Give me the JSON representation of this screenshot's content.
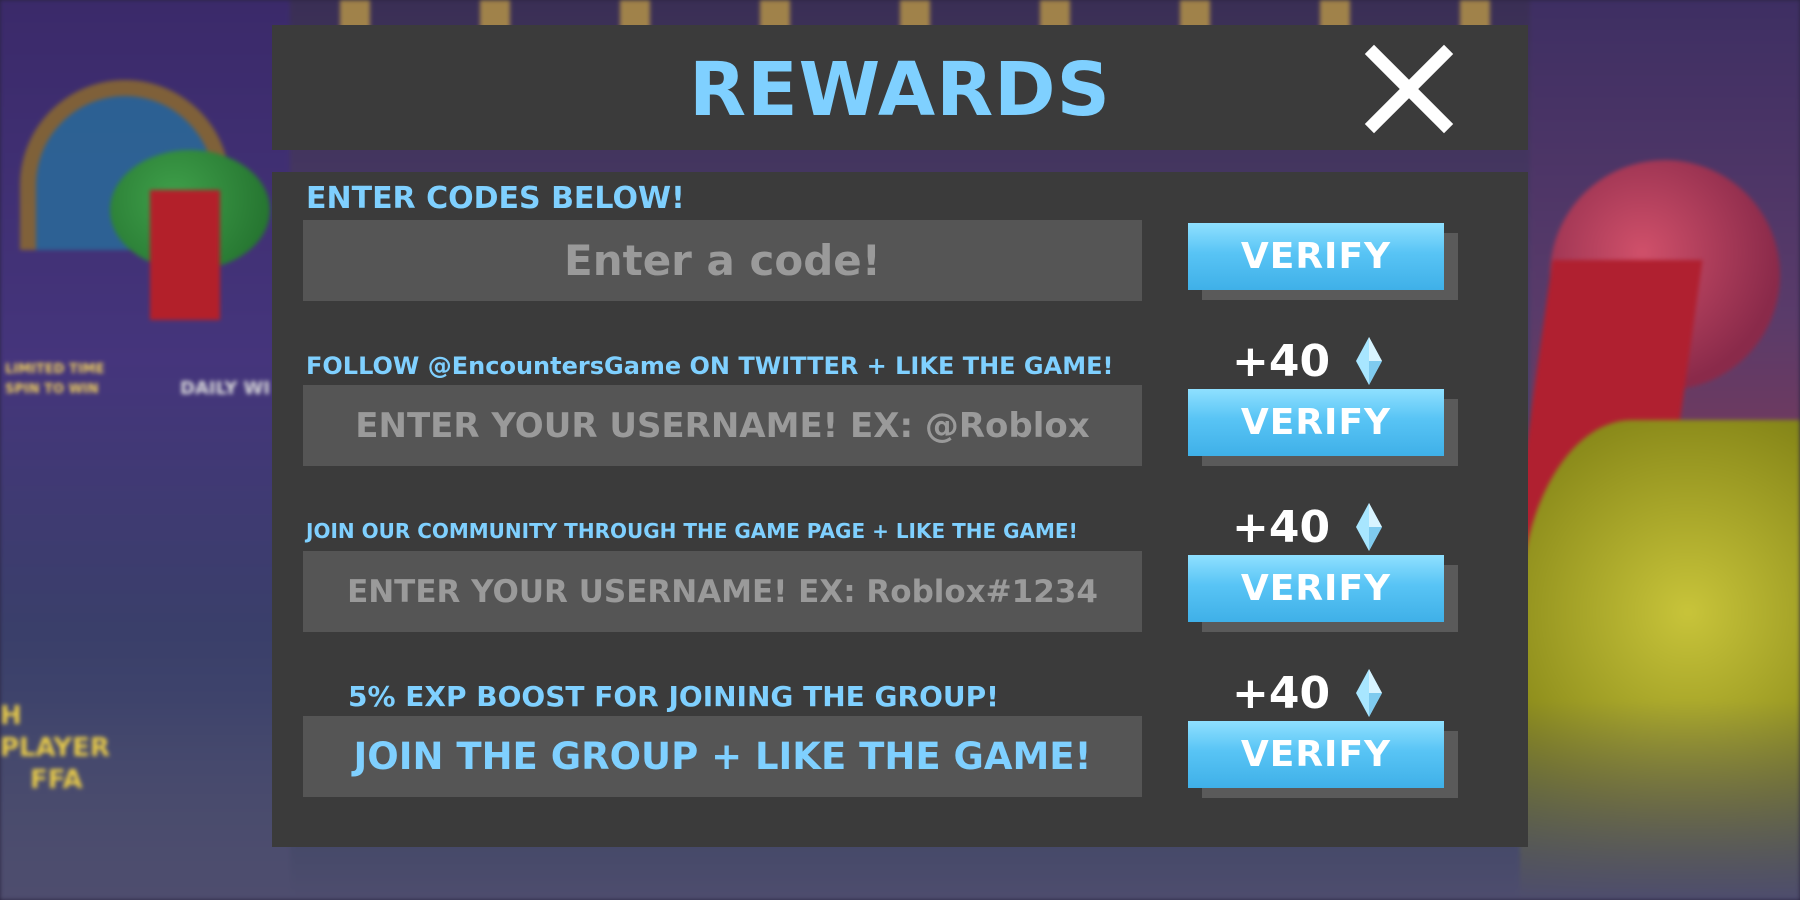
{
  "modal": {
    "title": "REWARDS",
    "close_icon": "close-icon",
    "accent_color": "#7fd0ff",
    "panel_color": "#3b3b3b",
    "input_color": "#555555",
    "button_color": "#58c4f5"
  },
  "codes": {
    "label": "ENTER CODES BELOW!",
    "placeholder": "Enter a code!",
    "verify_label": "VERIFY"
  },
  "twitter": {
    "label": "FOLLOW @EncountersGame ON TWITTER + LIKE THE GAME!",
    "placeholder": "ENTER YOUR USERNAME! EX: @Roblox",
    "reward_amount": "+40",
    "reward_icon": "diamond-gem-icon",
    "verify_label": "VERIFY"
  },
  "community": {
    "label": "JOIN OUR COMMUNITY THROUGH THE GAME PAGE + LIKE THE GAME!",
    "placeholder": "ENTER YOUR USERNAME! EX: Roblox#1234",
    "reward_amount": "+40",
    "reward_icon": "diamond-gem-icon",
    "verify_label": "VERIFY"
  },
  "group": {
    "label": "5% EXP BOOST FOR JOINING THE GROUP!",
    "action_text": "JOIN THE GROUP + LIKE THE GAME!",
    "reward_amount": "+40",
    "reward_icon": "diamond-gem-icon",
    "verify_label": "VERIFY"
  },
  "background": {
    "sign_1": "LIMITED TIME",
    "sign_2": "SPIN TO WIN",
    "sign_3": "DAILY WI",
    "sign_4": "H PLAYER",
    "sign_5": "FFA"
  }
}
